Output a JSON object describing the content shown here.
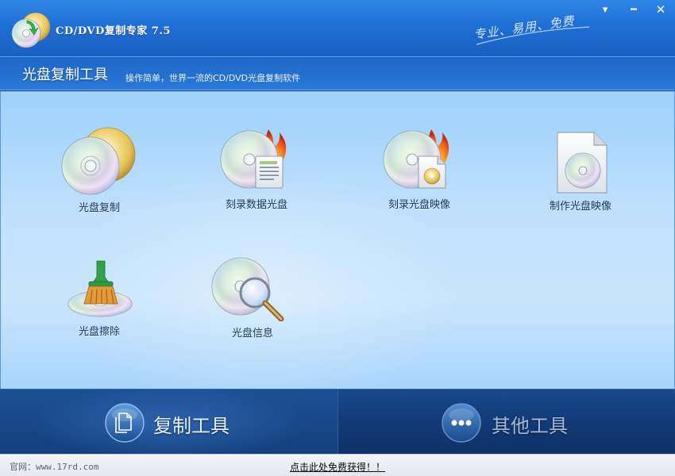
{
  "window": {
    "title": "CD/DVD复制专家 7.5",
    "slogan": "专业、易用、免费",
    "controls": {
      "menu": "▾",
      "minimize": "━",
      "close": "✕"
    }
  },
  "header": {
    "title": "光盘复制工具",
    "subtitle": "操作简单，世界一流的CD/DVD光盘复制软件"
  },
  "tools": [
    {
      "label": "光盘复制",
      "icon": "disc-copy-icon"
    },
    {
      "label": "刻录数据光盘",
      "icon": "burn-data-disc-icon"
    },
    {
      "label": "刻录光盘映像",
      "icon": "burn-disc-image-icon"
    },
    {
      "label": "制作光盘映像",
      "icon": "make-disc-image-icon"
    },
    {
      "label": "光盘擦除",
      "icon": "disc-erase-icon"
    },
    {
      "label": "光盘信息",
      "icon": "disc-info-icon"
    }
  ],
  "bottom_tabs": [
    {
      "label": "复制工具",
      "icon": "copy-document-icon",
      "active": true
    },
    {
      "label": "其他工具",
      "icon": "more-dots-icon",
      "active": false
    }
  ],
  "status": {
    "site": "官网：www.17rd.com",
    "promo": "点击此处免费获得！！"
  },
  "colors": {
    "titlebar": "#1f6fd6",
    "main_bg": "#bfe0fd",
    "bottom_bar": "#123a76",
    "label_text": "#13315f"
  }
}
